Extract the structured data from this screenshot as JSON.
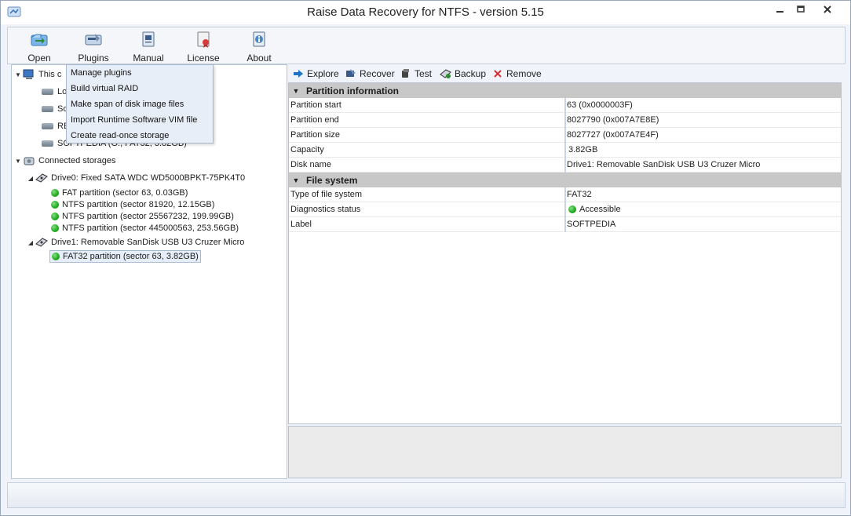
{
  "window": {
    "title": "Raise Data Recovery for NTFS - version 5.15"
  },
  "toolbar": {
    "open": "Open",
    "plugins": "Plugins",
    "manual": "Manual",
    "license": "License",
    "about": "About"
  },
  "menu": {
    "items": [
      "Manage plugins",
      "Build virtual RAID",
      "Make span of disk image files",
      "Import Runtime Software VIM file",
      "Create read-once storage"
    ]
  },
  "tree": {
    "this_computer": "This c",
    "local_items": [
      "Lo",
      "So",
      "RE",
      "SOFTPEDIA (G:, FAT32, 3.82GB)"
    ],
    "connected_storages": "Connected storages",
    "drive0": "Drive0: Fixed SATA WDC WD5000BPKT-75PK4T0",
    "drive0_parts": [
      "FAT partition (sector 63, 0.03GB)",
      "NTFS partition (sector 81920, 12.15GB)",
      "NTFS partition (sector 25567232, 199.99GB)",
      "NTFS partition (sector 445000563, 253.56GB)"
    ],
    "drive1": "Drive1: Removable SanDisk USB U3 Cruzer Micro",
    "drive1_parts": [
      "FAT32 partition (sector 63, 3.82GB)"
    ]
  },
  "actions": {
    "explore": "Explore",
    "recover": "Recover",
    "test": "Test",
    "backup": "Backup",
    "remove": "Remove"
  },
  "partition_info": {
    "header": "Partition information",
    "rows": [
      {
        "k": "Partition start",
        "v": "63 (0x0000003F)"
      },
      {
        "k": "Partition end",
        "v": "8027790 (0x007A7E8E)"
      },
      {
        "k": "Partition size",
        "v": "8027727 (0x007A7E4F)"
      },
      {
        "k": "Capacity",
        "v": "3.82GB"
      },
      {
        "k": "Disk name",
        "v": "Drive1: Removable SanDisk USB U3 Cruzer Micro"
      }
    ]
  },
  "file_system": {
    "header": "File system",
    "rows": [
      {
        "k": "Type of file system",
        "v": "FAT32"
      },
      {
        "k": "Diagnostics status",
        "v": "Accessible"
      },
      {
        "k": "Label",
        "v": "SOFTPEDIA"
      }
    ]
  },
  "colors": {
    "accent": "#1e72c8",
    "status_ok": "#12a012",
    "remove_red": "#d62b2b"
  }
}
